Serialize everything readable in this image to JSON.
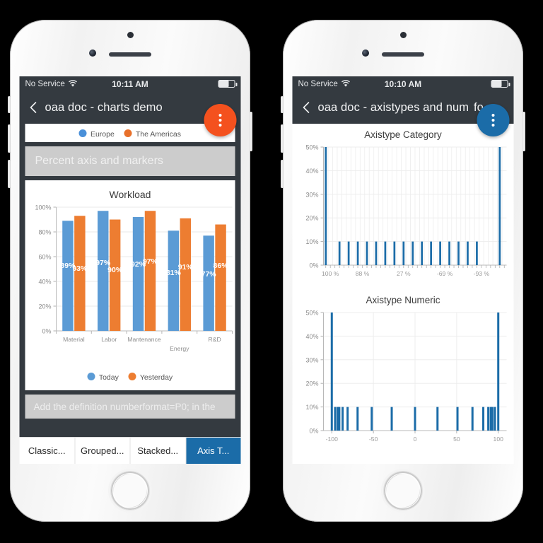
{
  "left_phone": {
    "status": {
      "carrier": "No Service",
      "wifi_icon": "wifi-icon",
      "time": "10:11 AM",
      "battery_icon": "battery-icon"
    },
    "appbar": {
      "back_icon": "back-chevron-icon",
      "title": "oaa doc - charts demo",
      "fab_icon": "overflow-menu-icon",
      "fab_color": "#F4511E"
    },
    "partial_legend": [
      {
        "label": "Europe",
        "color": "#4a90d9"
      },
      {
        "label": "The Americas",
        "color": "#e8702a"
      }
    ],
    "section_header": "Percent axis and markers",
    "hint_text": "Add the definition numberformat=P0; in the",
    "tabs": [
      {
        "label": "Classic...",
        "active": false
      },
      {
        "label": "Grouped...",
        "active": false
      },
      {
        "label": "Stacked...",
        "active": false
      },
      {
        "label": "Axis T...",
        "active": true
      }
    ],
    "chart_data": {
      "type": "bar",
      "title": "Workload",
      "categories": [
        "Material",
        "Labor",
        "Mantenance",
        "Energy",
        "R&D"
      ],
      "series": [
        {
          "name": "Today",
          "color": "#5b9bd5",
          "values": [
            89,
            97,
            92,
            81,
            77
          ],
          "labels": [
            "89%",
            "97%",
            "92%",
            "81%",
            "77%"
          ]
        },
        {
          "name": "Yesterday",
          "color": "#ed7d31",
          "values": [
            93,
            90,
            97,
            91,
            86
          ],
          "labels": [
            "93%",
            "90%",
            "97%",
            "91%",
            "86%"
          ]
        }
      ],
      "ylabel": "",
      "xlabel": "",
      "ylim": [
        0,
        100
      ],
      "yticks": [
        "0%",
        "20%",
        "40%",
        "60%",
        "80%",
        "100%"
      ],
      "ytick_values": [
        0,
        20,
        40,
        60,
        80,
        100
      ],
      "grid": true,
      "legend_position": "bottom",
      "data_label_format": "P0"
    }
  },
  "right_phone": {
    "status": {
      "carrier": "No Service",
      "wifi_icon": "wifi-icon",
      "time": "10:10 AM",
      "battery_icon": "battery-icon"
    },
    "appbar": {
      "back_icon": "back-chevron-icon",
      "title": "oaa doc - axistypes and num  fo...",
      "fab_icon": "overflow-menu-icon",
      "fab_color": "#1b6ca8"
    },
    "chart_data": [
      {
        "type": "bar",
        "title": "Axistype Category",
        "bar_color": "#1b6ca8",
        "ylim": [
          0,
          50
        ],
        "yticks": [
          "0%",
          "10%",
          "20%",
          "30%",
          "40%",
          "50%"
        ],
        "ytick_values": [
          0,
          10,
          20,
          30,
          40,
          50
        ],
        "xtick_labels": [
          "100 %",
          "88 %",
          "27 %",
          "-69 %",
          "-93 %"
        ],
        "xtick_positions": [
          1,
          8,
          17,
          26,
          34
        ],
        "category_count": 40,
        "values": [
          50,
          0,
          0,
          10,
          0,
          10,
          0,
          10,
          0,
          10,
          0,
          10,
          0,
          10,
          0,
          10,
          0,
          10,
          0,
          10,
          0,
          10,
          0,
          10,
          0,
          10,
          0,
          10,
          0,
          10,
          0,
          10,
          0,
          10,
          0,
          0,
          0,
          0,
          50,
          0
        ],
        "grid": true,
        "axis_type": "category"
      },
      {
        "type": "bar",
        "title": "Axistype Numeric",
        "bar_color": "#1b6ca8",
        "ylim": [
          0,
          50
        ],
        "yticks": [
          "0%",
          "10%",
          "20%",
          "30%",
          "40%",
          "50%"
        ],
        "ytick_values": [
          0,
          10,
          20,
          30,
          40,
          50
        ],
        "xlim": [
          -110,
          110
        ],
        "xticks": [
          "-100",
          "-50",
          "0",
          "50",
          "100"
        ],
        "xtick_values": [
          -100,
          -50,
          0,
          50,
          100
        ],
        "x": [
          -100,
          -96,
          -93,
          -91,
          -87,
          -81,
          -69,
          -52,
          -28,
          0,
          27,
          51,
          69,
          82,
          88,
          91,
          93,
          96,
          100
        ],
        "values": [
          50,
          10,
          10,
          10,
          10,
          10,
          10,
          10,
          10,
          10,
          10,
          10,
          10,
          10,
          10,
          10,
          10,
          10,
          50
        ],
        "grid": true,
        "axis_type": "numeric"
      }
    ]
  }
}
